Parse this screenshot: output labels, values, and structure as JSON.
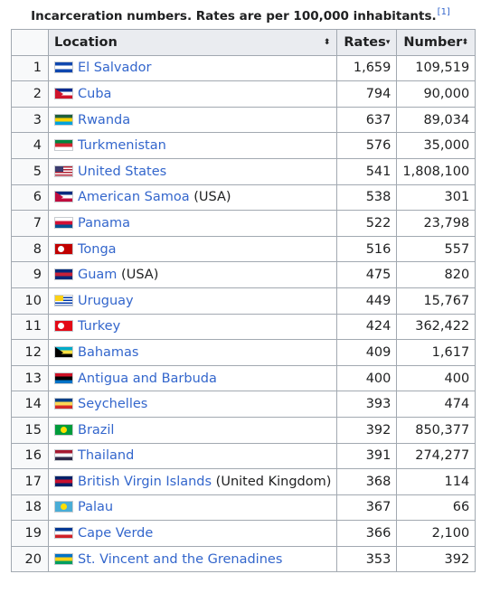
{
  "caption": {
    "text": "Incarceration numbers. Rates are per 100,000 inhabitants.",
    "ref": "[1]"
  },
  "columns": {
    "location": "Location",
    "rates": "Rates",
    "number": "Number",
    "sort_unsorted": "⬍",
    "sort_desc": "▾"
  },
  "rows": [
    {
      "rank": "1",
      "country": "El Salvador",
      "suffix": "",
      "rate": "1,659",
      "number": "109,519",
      "flag": "el-salvador",
      "colors": [
        "#0f47af",
        "#ffffff",
        "#0f47af"
      ]
    },
    {
      "rank": "2",
      "country": "Cuba",
      "suffix": "",
      "rate": "794",
      "number": "90,000",
      "flag": "cuba",
      "colors": [
        "#002a8f",
        "#ffffff",
        "#cf142b"
      ]
    },
    {
      "rank": "3",
      "country": "Rwanda",
      "suffix": "",
      "rate": "637",
      "number": "89,034",
      "flag": "rwanda",
      "colors": [
        "#20603d",
        "#fad201",
        "#00a1de"
      ]
    },
    {
      "rank": "4",
      "country": "Turkmenistan",
      "suffix": "",
      "rate": "576",
      "number": "35,000",
      "flag": "turkmenistan",
      "colors": [
        "#00843d",
        "#d22630",
        "#ffffff"
      ]
    },
    {
      "rank": "5",
      "country": "United States",
      "suffix": "",
      "rate": "541",
      "number": "1,808,100",
      "flag": "united-states",
      "colors": [
        "#b22234",
        "#ffffff",
        "#3c3b6e"
      ]
    },
    {
      "rank": "6",
      "country": "American Samoa",
      "suffix": " (USA)",
      "rate": "538",
      "number": "301",
      "flag": "american-samoa",
      "colors": [
        "#002b7f",
        "#ffffff",
        "#bf0d3e"
      ]
    },
    {
      "rank": "7",
      "country": "Panama",
      "suffix": "",
      "rate": "522",
      "number": "23,798",
      "flag": "panama",
      "colors": [
        "#ffffff",
        "#d21034",
        "#005293"
      ]
    },
    {
      "rank": "8",
      "country": "Tonga",
      "suffix": "",
      "rate": "516",
      "number": "557",
      "flag": "tonga",
      "colors": [
        "#c10000",
        "#ffffff",
        "#c10000"
      ]
    },
    {
      "rank": "9",
      "country": "Guam",
      "suffix": " (USA)",
      "rate": "475",
      "number": "820",
      "flag": "guam",
      "colors": [
        "#00297b",
        "#c62139",
        "#00297b"
      ]
    },
    {
      "rank": "10",
      "country": "Uruguay",
      "suffix": "",
      "rate": "449",
      "number": "15,767",
      "flag": "uruguay",
      "colors": [
        "#ffffff",
        "#0038a8",
        "#fcd116"
      ]
    },
    {
      "rank": "11",
      "country": "Turkey",
      "suffix": "",
      "rate": "424",
      "number": "362,422",
      "flag": "turkey",
      "colors": [
        "#e30a17",
        "#ffffff",
        "#e30a17"
      ]
    },
    {
      "rank": "12",
      "country": "Bahamas",
      "suffix": "",
      "rate": "409",
      "number": "1,617",
      "flag": "bahamas",
      "colors": [
        "#00abc9",
        "#fae042",
        "#000000"
      ]
    },
    {
      "rank": "13",
      "country": "Antigua and Barbuda",
      "suffix": "",
      "rate": "400",
      "number": "400",
      "flag": "antigua-and-barbuda",
      "colors": [
        "#ce1126",
        "#000000",
        "#0072c6"
      ]
    },
    {
      "rank": "14",
      "country": "Seychelles",
      "suffix": "",
      "rate": "393",
      "number": "474",
      "flag": "seychelles",
      "colors": [
        "#003f87",
        "#fcd856",
        "#d62828"
      ]
    },
    {
      "rank": "15",
      "country": "Brazil",
      "suffix": "",
      "rate": "392",
      "number": "850,377",
      "flag": "brazil",
      "colors": [
        "#009c3b",
        "#ffdf00",
        "#002776"
      ]
    },
    {
      "rank": "16",
      "country": "Thailand",
      "suffix": "",
      "rate": "391",
      "number": "274,277",
      "flag": "thailand",
      "colors": [
        "#a51931",
        "#f4f5f8",
        "#2d2a4a"
      ]
    },
    {
      "rank": "17",
      "country": "British Virgin Islands",
      "suffix": " (United Kingdom)",
      "rate": "368",
      "number": "114",
      "flag": "british-virgin-islands",
      "colors": [
        "#012169",
        "#c8102e",
        "#012169"
      ]
    },
    {
      "rank": "18",
      "country": "Palau",
      "suffix": "",
      "rate": "367",
      "number": "66",
      "flag": "palau",
      "colors": [
        "#4aadd6",
        "#ffde00",
        "#4aadd6"
      ]
    },
    {
      "rank": "19",
      "country": "Cape Verde",
      "suffix": "",
      "rate": "366",
      "number": "2,100",
      "flag": "cape-verde",
      "colors": [
        "#003893",
        "#ffffff",
        "#cf2027"
      ]
    },
    {
      "rank": "20",
      "country": "St. Vincent and the Grenadines",
      "suffix": "",
      "rate": "353",
      "number": "392",
      "flag": "st-vincent-and-the-grenadines",
      "colors": [
        "#0072c6",
        "#fcd116",
        "#009e60"
      ]
    }
  ]
}
